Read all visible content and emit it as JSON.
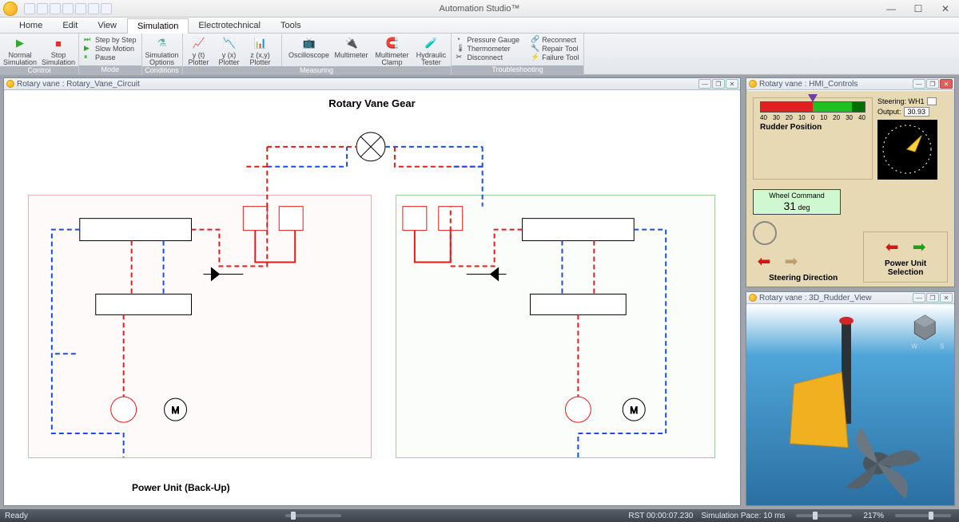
{
  "app": {
    "title": "Automation Studio™"
  },
  "menu": {
    "tabs": [
      "Home",
      "Edit",
      "View",
      "Simulation",
      "Electrotechnical",
      "Tools"
    ],
    "active": 3
  },
  "ribbon": {
    "control": {
      "label": "Control",
      "normal": "Normal Simulation",
      "stop": "Stop Simulation"
    },
    "mode": {
      "label": "Mode",
      "step": "Step by Step",
      "slow": "Slow Motion",
      "pause": "Pause"
    },
    "conditions": {
      "label": "Conditions",
      "opts": "Simulation Options"
    },
    "measuring": {
      "label": "Measuring",
      "yt": "y (t) Plotter",
      "yx": "y (x) Plotter",
      "zxy": "z (x,y) Plotter",
      "osc": "Oscilloscope",
      "mm": "Multimeter",
      "mmc": "Multimeter Clamp",
      "ht": "Hydraulic Tester"
    },
    "trouble": {
      "label": "Troubleshooting",
      "pg": "Pressure Gauge",
      "th": "Thermometer",
      "dc": "Disconnect",
      "rc": "Reconnect",
      "rt": "Repair Tool",
      "ft": "Failure Tool"
    }
  },
  "panes": {
    "circuit": {
      "title": "Rotary vane : Rotary_Vane_Circuit",
      "heading": "Rotary Vane Gear",
      "backup_label": "Power Unit (Back-Up)"
    },
    "hmi": {
      "title": "Rotary vane : HMI_Controls",
      "scale_ticks": [
        "40",
        "30",
        "20",
        "10",
        "0",
        "10",
        "20",
        "30",
        "40"
      ],
      "scale_label": "Rudder Position",
      "wheel_cmd_label": "Wheel Command",
      "wheel_cmd_value": "31",
      "wheel_cmd_unit": "deg",
      "steering_label": "Steering: WH1",
      "output_label": "Output:",
      "output_value": "30.93",
      "steer_dir": "Steering Direction",
      "pus": "Power Unit Selection"
    },
    "view3d": {
      "title": "Rotary vane : 3D_Rudder_View"
    }
  },
  "status": {
    "ready": "Ready",
    "rst_label": "RST",
    "rst_time": "00:00:07.230",
    "pace": "Simulation Pace: 10 ms",
    "zoom": "217%"
  }
}
